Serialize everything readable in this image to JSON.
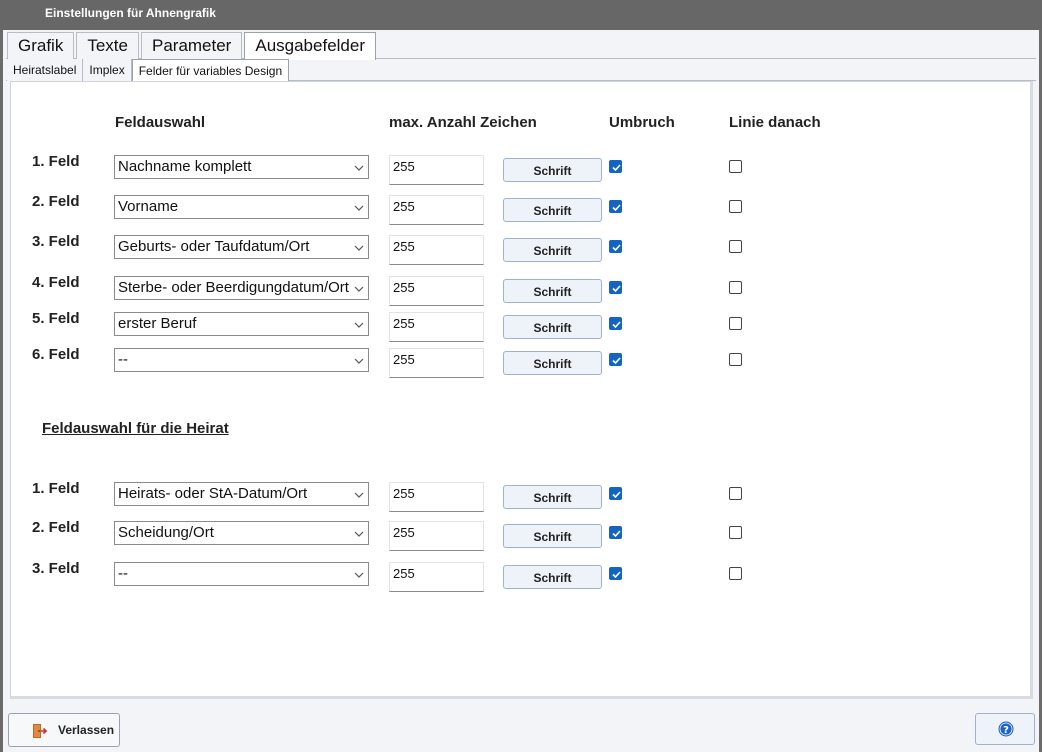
{
  "window": {
    "title": "Einstellungen für Ahnengrafik"
  },
  "tabs_main": [
    "Grafik",
    "Texte",
    "Parameter",
    "Ausgabefelder"
  ],
  "tabs_sub": [
    "Heiratslabel",
    "Implex",
    "Felder für variables Design"
  ],
  "headers": {
    "feldauswahl": "Feldauswahl",
    "max_chars": "max. Anzahl Zeichen",
    "umbruch": "Umbruch",
    "linie": "Linie danach"
  },
  "fields": [
    {
      "label": "1. Feld",
      "value": "Nachname komplett",
      "max": "255",
      "font_button": "Schrift",
      "umbruch": true,
      "linie": false
    },
    {
      "label": "2. Feld",
      "value": "Vorname",
      "max": "255",
      "font_button": "Schrift",
      "umbruch": true,
      "linie": false
    },
    {
      "label": "3. Feld",
      "value": "Geburts- oder Taufdatum/Ort",
      "max": "255",
      "font_button": "Schrift",
      "umbruch": true,
      "linie": false
    },
    {
      "label": "4. Feld",
      "value": "Sterbe- oder Beerdigungdatum/Ort",
      "max": "255",
      "font_button": "Schrift",
      "umbruch": true,
      "linie": false
    },
    {
      "label": "5. Feld",
      "value": "erster Beruf",
      "max": "255",
      "font_button": "Schrift",
      "umbruch": true,
      "linie": false
    },
    {
      "label": "6. Feld",
      "value": "--",
      "max": "255",
      "font_button": "Schrift",
      "umbruch": true,
      "linie": false
    }
  ],
  "marriage_section_title": "Feldauswahl für die Heirat",
  "marriage_fields": [
    {
      "label": "1. Feld",
      "value": "Heirats- oder StA-Datum/Ort",
      "max": "255",
      "font_button": "Schrift",
      "umbruch": true,
      "linie": false
    },
    {
      "label": "2. Feld",
      "value": "Scheidung/Ort",
      "max": "255",
      "font_button": "Schrift",
      "umbruch": true,
      "linie": false
    },
    {
      "label": "3. Feld",
      "value": "--",
      "max": "255",
      "font_button": "Schrift",
      "umbruch": true,
      "linie": false
    }
  ],
  "footer": {
    "leave_label": "Verlassen"
  },
  "icons": {
    "leave": "exit-door-icon",
    "help": "help-icon",
    "dropdown": "chevron-down-icon"
  },
  "colors": {
    "checkbox_checked": "#1565c0",
    "titlebar": "#676767",
    "help": "#1e63c8"
  }
}
